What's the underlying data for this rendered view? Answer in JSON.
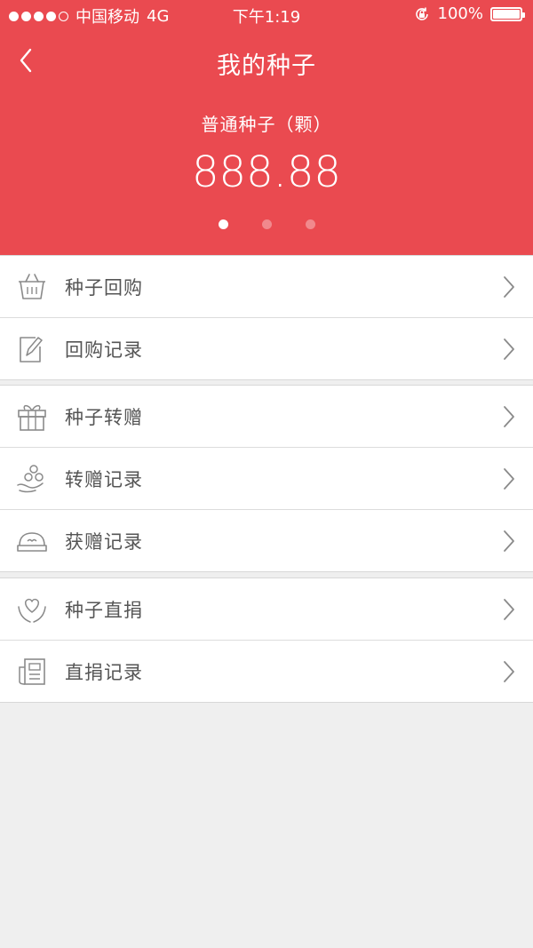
{
  "status_bar": {
    "carrier": "中国移动",
    "network": "4G",
    "time": "下午1:19",
    "battery": "100%",
    "signal_bars": 5,
    "signal_filled": 4
  },
  "nav": {
    "title": "我的种子",
    "back_icon": "back-chevron-icon"
  },
  "summary": {
    "label": "普通种子（颗）",
    "value": "888.88",
    "pages": 3,
    "active_page": 1
  },
  "colors": {
    "header": "#ea4a50",
    "background": "#efefef",
    "icon": "#8a8a8a"
  },
  "groups": [
    {
      "items": [
        {
          "label": "种子回购",
          "icon": "basket-icon"
        },
        {
          "label": "回购记录",
          "icon": "edit-note-icon"
        }
      ]
    },
    {
      "items": [
        {
          "label": "种子转赠",
          "icon": "gift-icon"
        },
        {
          "label": "转赠记录",
          "icon": "hand-coins-icon"
        },
        {
          "label": "获赠记录",
          "icon": "receive-tray-icon"
        }
      ]
    },
    {
      "items": [
        {
          "label": "种子直捐",
          "icon": "heart-hands-icon"
        },
        {
          "label": "直捐记录",
          "icon": "document-list-icon"
        }
      ]
    }
  ]
}
